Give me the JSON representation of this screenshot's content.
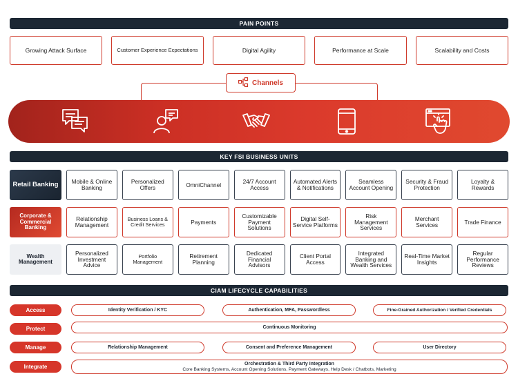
{
  "pain_points": {
    "title": "PAIN POINTS",
    "items": [
      "Growing Attack Surface",
      "Customer Experience Ecpectations",
      "Digital Agility",
      "Performance at Scale",
      "Scalability and Costs"
    ]
  },
  "channels": {
    "label": "Channels",
    "icons": [
      "chat-bubbles-icon",
      "user-chat-icon",
      "handshake-icon",
      "mobile-phone-icon",
      "web-click-icon"
    ]
  },
  "business_units": {
    "title": "KEY FSI BUSINESS UNITS",
    "rows": [
      {
        "label": "Retail Banking",
        "cells": [
          "Mobile & Online Banking",
          "Personalized Offers",
          "OmniChannel",
          "24/7 Account Access",
          "Automated Alerts & Notifications",
          "Seamless Account Opening",
          "Security & Fraud Protection",
          "Loyalty & Rewards"
        ]
      },
      {
        "label": "Corporate & Commercial Banking",
        "cells": [
          "Relationship Management",
          "Business Loans & Credit Services",
          "Payments",
          "Customizable Payment Solutions",
          "Digital Self-Service Platforms",
          "Risk Management Services",
          "Merchant Services",
          "Trade Finance"
        ]
      },
      {
        "label": "Wealth Management",
        "cells": [
          "Personalized Investment Advice",
          "Portfolio Management",
          "Retirement Planning",
          "Dedicated Financial Advisors",
          "Client Portal Access",
          "Integrated Banking and Wealth Services",
          "Real-Time Market Insights",
          "Regular Performance Reviews"
        ]
      }
    ]
  },
  "ciam": {
    "title": "CIAM LIFECYCLE CAPABILITIES",
    "access": {
      "label": "Access",
      "items": [
        "Identity Verification / KYC",
        "Authentication, MFA, Passwordless",
        "Fine-Grained Authorization / Verified Credentials"
      ]
    },
    "protect": {
      "label": "Protect",
      "items": [
        "Continuous Monitoring"
      ]
    },
    "manage": {
      "label": "Manage",
      "items": [
        "Relationship Management",
        "Consent and Preference Management",
        "User Directory"
      ]
    },
    "integrate": {
      "label": "Integrate",
      "title": "Orchestration & Third Party Integration",
      "subtitle": "Core Banking Systems, Account Opening Solutions, Payment Gateways, Help Desk / Chatbots, Marketing"
    }
  },
  "colors": {
    "accent_red": "#cf3a2b",
    "dark_navy": "#1c2733"
  }
}
